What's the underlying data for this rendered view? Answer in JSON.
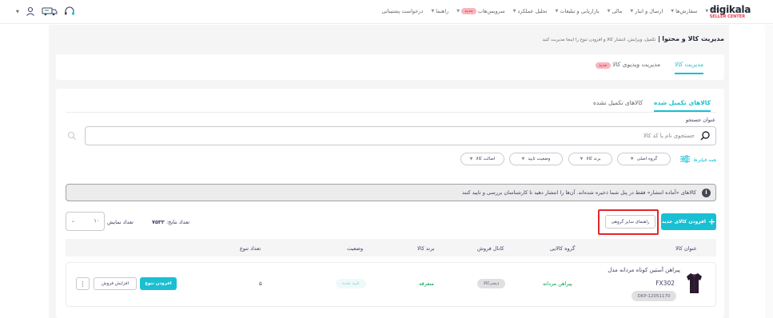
{
  "brand": {
    "name": "digikala",
    "sub": "SELLER CENTER"
  },
  "nav": [
    {
      "label": "کالا",
      "has_caret": true
    },
    {
      "label": "سفارش‌ها",
      "has_caret": true
    },
    {
      "label": "ارسال و انبار",
      "has_caret": true
    },
    {
      "label": "مالی",
      "has_caret": true
    },
    {
      "label": "بازاریابی و تبلیغات",
      "has_caret": true
    },
    {
      "label": "تحلیل عملکرد",
      "has_caret": true
    },
    {
      "label": "سرویس‌هاب",
      "has_caret": true,
      "badge": "جدید"
    },
    {
      "label": "راهنما",
      "has_caret": true
    },
    {
      "label": "درخواست پشتیبانی",
      "has_caret": false
    }
  ],
  "page": {
    "title": "مدیریت کالا و محتوا",
    "subtitle": "تکمیل، ویرایش، انتشار کالا و افزودن تنوع را اینجا مدیریت کنید"
  },
  "main_tabs": [
    {
      "label": "مدیریت کالا",
      "active": true
    },
    {
      "label": "مدیریت ویدیوی کالا",
      "badge": "جدید",
      "active": false
    }
  ],
  "sub_tabs": [
    {
      "label": "کالاهای تکمیل شده",
      "active": true
    },
    {
      "label": "کالاهای تکمیل نشده",
      "active": false
    }
  ],
  "search": {
    "label": "عنوان جستجو",
    "placeholder": "جستجوی نام یا کد کالا"
  },
  "filters": {
    "all_label": "همه فیلترها",
    "chips": [
      "گروه اصلی",
      "برند کالا",
      "وضعیت تایید",
      "اصالت کالا"
    ]
  },
  "notice": "کالاهای «آماده انتشار» فقط در پنل شما ذخیره شده‌اند. آن‌ها را انتشار دهید تا کارشناسان بررسی و تایید کنند",
  "actions": {
    "add_product": "افزودن کالای جدید",
    "group_guide": "راهنمای سایز گروهی"
  },
  "results": {
    "label": "تعداد نتایج:",
    "count": "۷۵۳۲"
  },
  "page_size": {
    "label": "تعداد نمایش",
    "value": "۱۰"
  },
  "table": {
    "headers": [
      "عنوان کالا",
      "گروه کالایی",
      "کانال فروش",
      "برند کالا",
      "وضعیت",
      "تعداد تنوع"
    ],
    "rows": [
      {
        "title": "پیراهن آستین کوتاه مردانه مدل",
        "model": "FX302",
        "dkp": "DKP-12051170",
        "group": "پیراهن مردانه",
        "channel": "دیجی‌کالا",
        "brand": "متفرقه",
        "status": "تایید شده",
        "variants": "۵",
        "btn_add_variant": "افزودن تنوع",
        "btn_increase_sale": "افزایش فروش"
      }
    ]
  }
}
